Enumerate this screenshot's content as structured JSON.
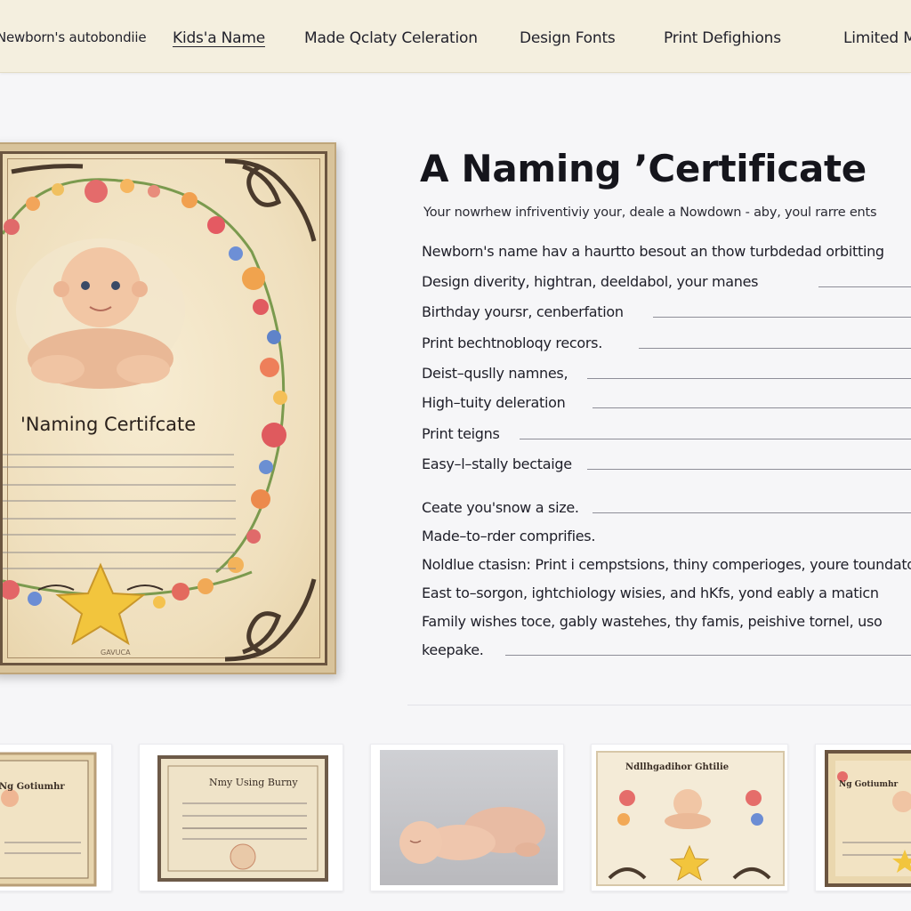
{
  "nav": {
    "items": [
      {
        "label": "Newborn's autobondiie",
        "active": false
      },
      {
        "label": "Kids'a Name",
        "active": true
      },
      {
        "label": "Made Qclaty Celeration",
        "active": false
      },
      {
        "label": "Design Fonts",
        "active": false
      },
      {
        "label": "Print Defighions",
        "active": false
      },
      {
        "label": "Limited M",
        "active": false
      }
    ]
  },
  "certificate": {
    "title": "'Naming Certifcate",
    "signature": "GAVUCA"
  },
  "content": {
    "heading": "A Naming ’Certificate",
    "intro": "Your nowrhew infriventiviy your,  deale a Nowdown - aby, youl rarre ents",
    "rows": [
      {
        "label": "Newborn's name  hav a   haurtto besout an thow turbdedad orbitting"
      },
      {
        "label": "Design diverity,  hightran, deeldabol,  your manes"
      },
      {
        "label": "Birthday yoursr,  cenberfation"
      },
      {
        "label": "Print bechtnobloqy recors."
      },
      {
        "label": "Deist–quslly namnes,"
      },
      {
        "label": "High–tuity deleration"
      },
      {
        "label": "Print teigns"
      },
      {
        "label": "Easy–l–stally bectaige"
      },
      {
        "label": "Ceate you'snow a size."
      },
      {
        "label": "Made–to–rder comprifies."
      },
      {
        "label": "Noldlue ctasisn:  Print i cempstsions,  thiny comperioges,  youre toundaton"
      },
      {
        "label": "East to–sorgon,  ightchiology   wisies,  and hKfs,  yond eably a maticn"
      },
      {
        "label": "Family wishes toce,   gably wastehes,   thy famis, peishive tornel,   uso"
      },
      {
        "label": "keepake."
      }
    ]
  },
  "thumbnails": [
    {
      "label": "Ng Gotiumhr"
    },
    {
      "label": "Nmy Using Burny"
    },
    {
      "label": ""
    },
    {
      "label": "Ndllhgadihor Ghtilie"
    },
    {
      "label": "Ng Gotiumhr"
    }
  ],
  "colors": {
    "nav_bg": "#f4efdf",
    "page_bg": "#f6f6f8",
    "parchment": "#efdfbd",
    "frame_dark": "#6b5540",
    "star": "#f2c53d"
  }
}
